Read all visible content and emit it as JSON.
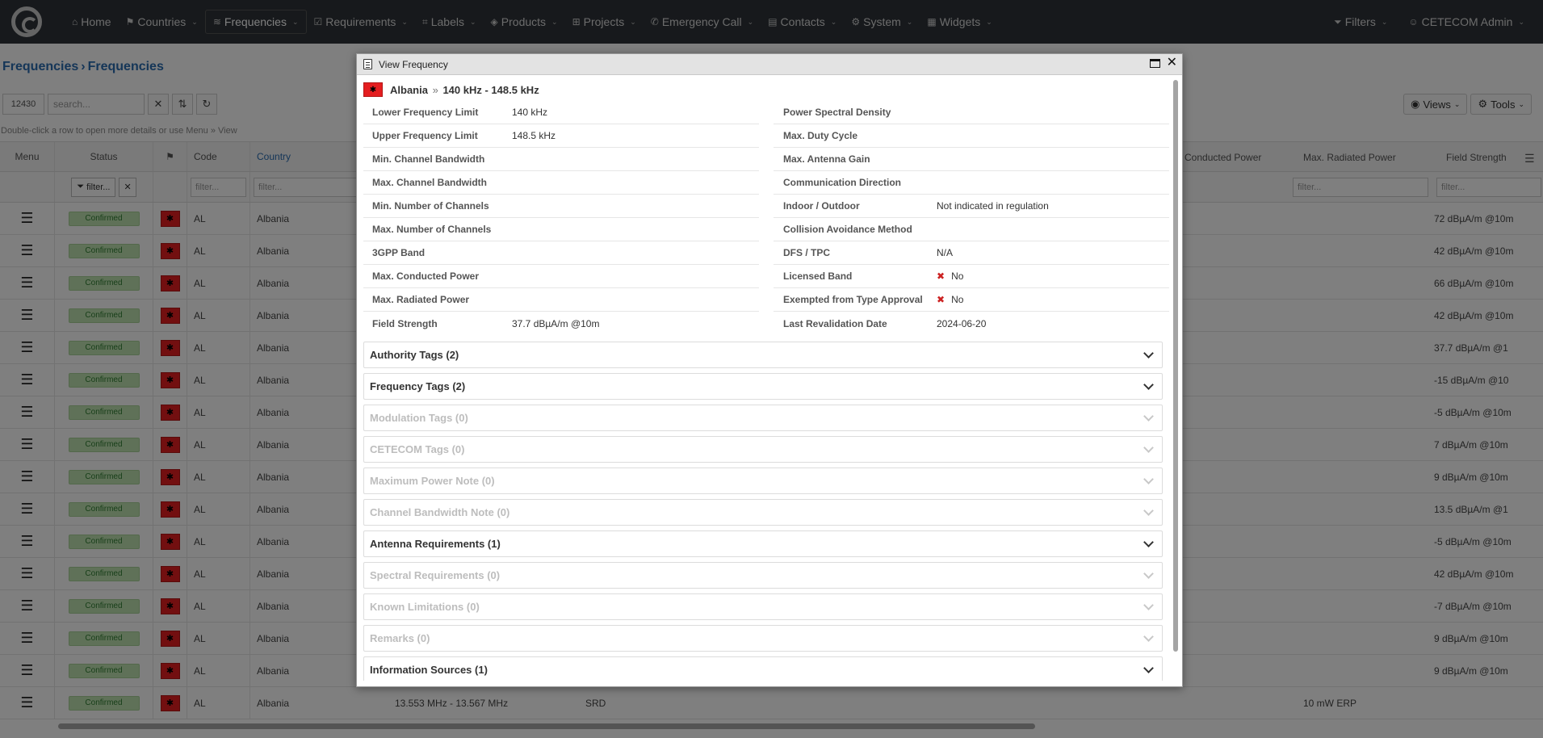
{
  "nav": {
    "items": [
      {
        "icon": "home-icon",
        "glyph": "⌂",
        "label": "Home"
      },
      {
        "icon": "flag-icon",
        "glyph": "⚑",
        "label": "Countries"
      },
      {
        "icon": "wifi-icon",
        "glyph": "≋",
        "label": "Frequencies"
      },
      {
        "icon": "checklist-icon",
        "glyph": "☑",
        "label": "Requirements"
      },
      {
        "icon": "tags-icon",
        "glyph": "⌗",
        "label": "Labels"
      },
      {
        "icon": "cube-icon",
        "glyph": "◈",
        "label": "Products"
      },
      {
        "icon": "sitemap-icon",
        "glyph": "⊞",
        "label": "Projects"
      },
      {
        "icon": "phone-icon",
        "glyph": "✆",
        "label": "Emergency Call"
      },
      {
        "icon": "address-card-icon",
        "glyph": "▤",
        "label": "Contacts"
      },
      {
        "icon": "gears-icon",
        "glyph": "⚙",
        "label": "System"
      },
      {
        "icon": "grid-icon",
        "glyph": "▦",
        "label": "Widgets"
      }
    ],
    "filters": "Filters",
    "user": "CETECOM Admin"
  },
  "breadcrumb": {
    "part1": "Frequencies",
    "sep": "›",
    "part2": "Frequencies"
  },
  "toolbar": {
    "count": "12430",
    "search_placeholder": "search...",
    "views": "Views",
    "tools": "Tools"
  },
  "hint": "Double-click a row to open more details or use Menu » View",
  "table": {
    "headers": {
      "menu": "Menu",
      "status": "Status",
      "code": "Code",
      "country": "Country",
      "conducted": "Conducted Power",
      "radiated": "Max. Radiated Power",
      "field": "Field Strength"
    },
    "filter_placeholder": "filter...",
    "status_filter": "filter...",
    "rows": [
      {
        "status": "Confirmed",
        "code": "AL",
        "country": "Albania",
        "field": "72 dBµA/m @10m"
      },
      {
        "status": "Confirmed",
        "code": "AL",
        "country": "Albania",
        "field": "42 dBµA/m @10m"
      },
      {
        "status": "Confirmed",
        "code": "AL",
        "country": "Albania",
        "field": "66 dBµA/m @10m"
      },
      {
        "status": "Confirmed",
        "code": "AL",
        "country": "Albania",
        "field": "42 dBµA/m @10m"
      },
      {
        "status": "Confirmed",
        "code": "AL",
        "country": "Albania",
        "field": "37.7 dBµA/m @1"
      },
      {
        "status": "Confirmed",
        "code": "AL",
        "country": "Albania",
        "field": "-15 dBµA/m @10"
      },
      {
        "status": "Confirmed",
        "code": "AL",
        "country": "Albania",
        "field": "-5 dBµA/m @10m"
      },
      {
        "status": "Confirmed",
        "code": "AL",
        "country": "Albania",
        "field": "7 dBµA/m @10m"
      },
      {
        "status": "Confirmed",
        "code": "AL",
        "country": "Albania",
        "field": "9 dBµA/m @10m"
      },
      {
        "status": "Confirmed",
        "code": "AL",
        "country": "Albania",
        "field": "13.5 dBµA/m @1"
      },
      {
        "status": "Confirmed",
        "code": "AL",
        "country": "Albania",
        "field": "-5 dBµA/m @10m"
      },
      {
        "status": "Confirmed",
        "code": "AL",
        "country": "Albania",
        "field": "42 dBµA/m @10m"
      },
      {
        "status": "Confirmed",
        "code": "AL",
        "country": "Albania",
        "field": "-7 dBµA/m @10m"
      },
      {
        "status": "Confirmed",
        "code": "AL",
        "country": "Albania",
        "field": "9 dBµA/m @10m"
      },
      {
        "status": "Confirmed",
        "code": "AL",
        "country": "Albania",
        "field": "9 dBµA/m @10m"
      },
      {
        "status": "Confirmed",
        "code": "AL",
        "country": "Albania",
        "field": ""
      }
    ],
    "last_row": {
      "range": "13.553 MHz - 13.567 MHz",
      "type": "SRD",
      "radiated": "10 mW ERP"
    }
  },
  "modal": {
    "title": "View Frequency",
    "country": "Albania",
    "sep": "»",
    "range": "140 kHz - 148.5 kHz",
    "left": [
      {
        "k": "Lower Frequency Limit",
        "v": "140 kHz"
      },
      {
        "k": "Upper Frequency Limit",
        "v": "148.5 kHz"
      },
      {
        "k": "Min. Channel Bandwidth",
        "v": ""
      },
      {
        "k": "Max. Channel Bandwidth",
        "v": ""
      },
      {
        "k": "Min. Number of Channels",
        "v": ""
      },
      {
        "k": "Max. Number of Channels",
        "v": ""
      },
      {
        "k": "3GPP Band",
        "v": ""
      },
      {
        "k": "Max. Conducted Power",
        "v": ""
      },
      {
        "k": "Max. Radiated Power",
        "v": ""
      },
      {
        "k": "Field Strength",
        "v": "37.7 dBµA/m @10m"
      }
    ],
    "right": [
      {
        "k": "Power Spectral Density",
        "v": "",
        "x": false
      },
      {
        "k": "Max. Duty Cycle",
        "v": "",
        "x": false
      },
      {
        "k": "Max. Antenna Gain",
        "v": "",
        "x": false
      },
      {
        "k": "Communication Direction",
        "v": "",
        "x": false
      },
      {
        "k": "Indoor / Outdoor",
        "v": "Not indicated in regulation",
        "x": false
      },
      {
        "k": "Collision Avoidance Method",
        "v": "",
        "x": false
      },
      {
        "k": "DFS / TPC",
        "v": "N/A",
        "x": false
      },
      {
        "k": "Licensed Band",
        "v": "No",
        "x": true
      },
      {
        "k": "Exempted from Type Approval",
        "v": "No",
        "x": true
      },
      {
        "k": "Last Revalidation Date",
        "v": "2024-06-20",
        "x": false
      }
    ],
    "sections": [
      {
        "label": "Authority Tags (2)",
        "enabled": true
      },
      {
        "label": "Frequency Tags (2)",
        "enabled": true
      },
      {
        "label": "Modulation Tags (0)",
        "enabled": false
      },
      {
        "label": "CETECOM Tags (0)",
        "enabled": false
      },
      {
        "label": "Maximum Power Note (0)",
        "enabled": false
      },
      {
        "label": "Channel Bandwidth Note (0)",
        "enabled": false
      },
      {
        "label": "Antenna Requirements (1)",
        "enabled": true
      },
      {
        "label": "Spectral Requirements (0)",
        "enabled": false
      },
      {
        "label": "Known Limitations (0)",
        "enabled": false
      },
      {
        "label": "Remarks (0)",
        "enabled": false
      },
      {
        "label": "Information Sources (1)",
        "enabled": true
      }
    ]
  },
  "colors": {
    "navbar": "#2e3338",
    "link": "#2b6cb0",
    "confirmed_bg": "#bfe3b0",
    "flag_red": "#e41e20",
    "x_red": "#cc2222"
  }
}
